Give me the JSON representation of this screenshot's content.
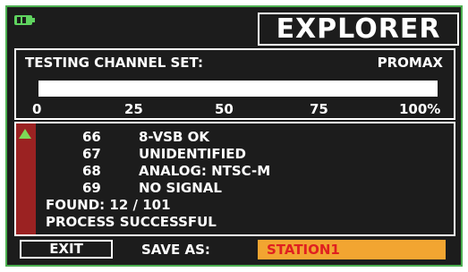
{
  "header": {
    "battery_icon": "battery-icon",
    "title": "EXPLORER"
  },
  "progress": {
    "label": "TESTING CHANNEL SET:",
    "brand": "PROMAX",
    "percent": 100,
    "ticks": [
      "0",
      "25",
      "50",
      "75",
      "100%"
    ]
  },
  "results": {
    "rows": [
      {
        "channel": "66",
        "status": "8-VSB OK"
      },
      {
        "channel": "67",
        "status": "UNIDENTIFIED"
      },
      {
        "channel": "68",
        "status": "ANALOG: NTSC-M"
      },
      {
        "channel": "69",
        "status": "NO SIGNAL"
      }
    ],
    "found": "FOUND: 12 / 101",
    "message": "PROCESS SUCCESSFUL",
    "scroll_icon": "scroll-up-icon"
  },
  "footer": {
    "exit_label": "EXIT",
    "save_as_label": "SAVE AS:",
    "filename": "STATION1"
  },
  "colors": {
    "frame": "#4caf50",
    "scrollbar": "#9b2222",
    "filename_bg": "#f2a531",
    "filename_text": "#e02020"
  }
}
